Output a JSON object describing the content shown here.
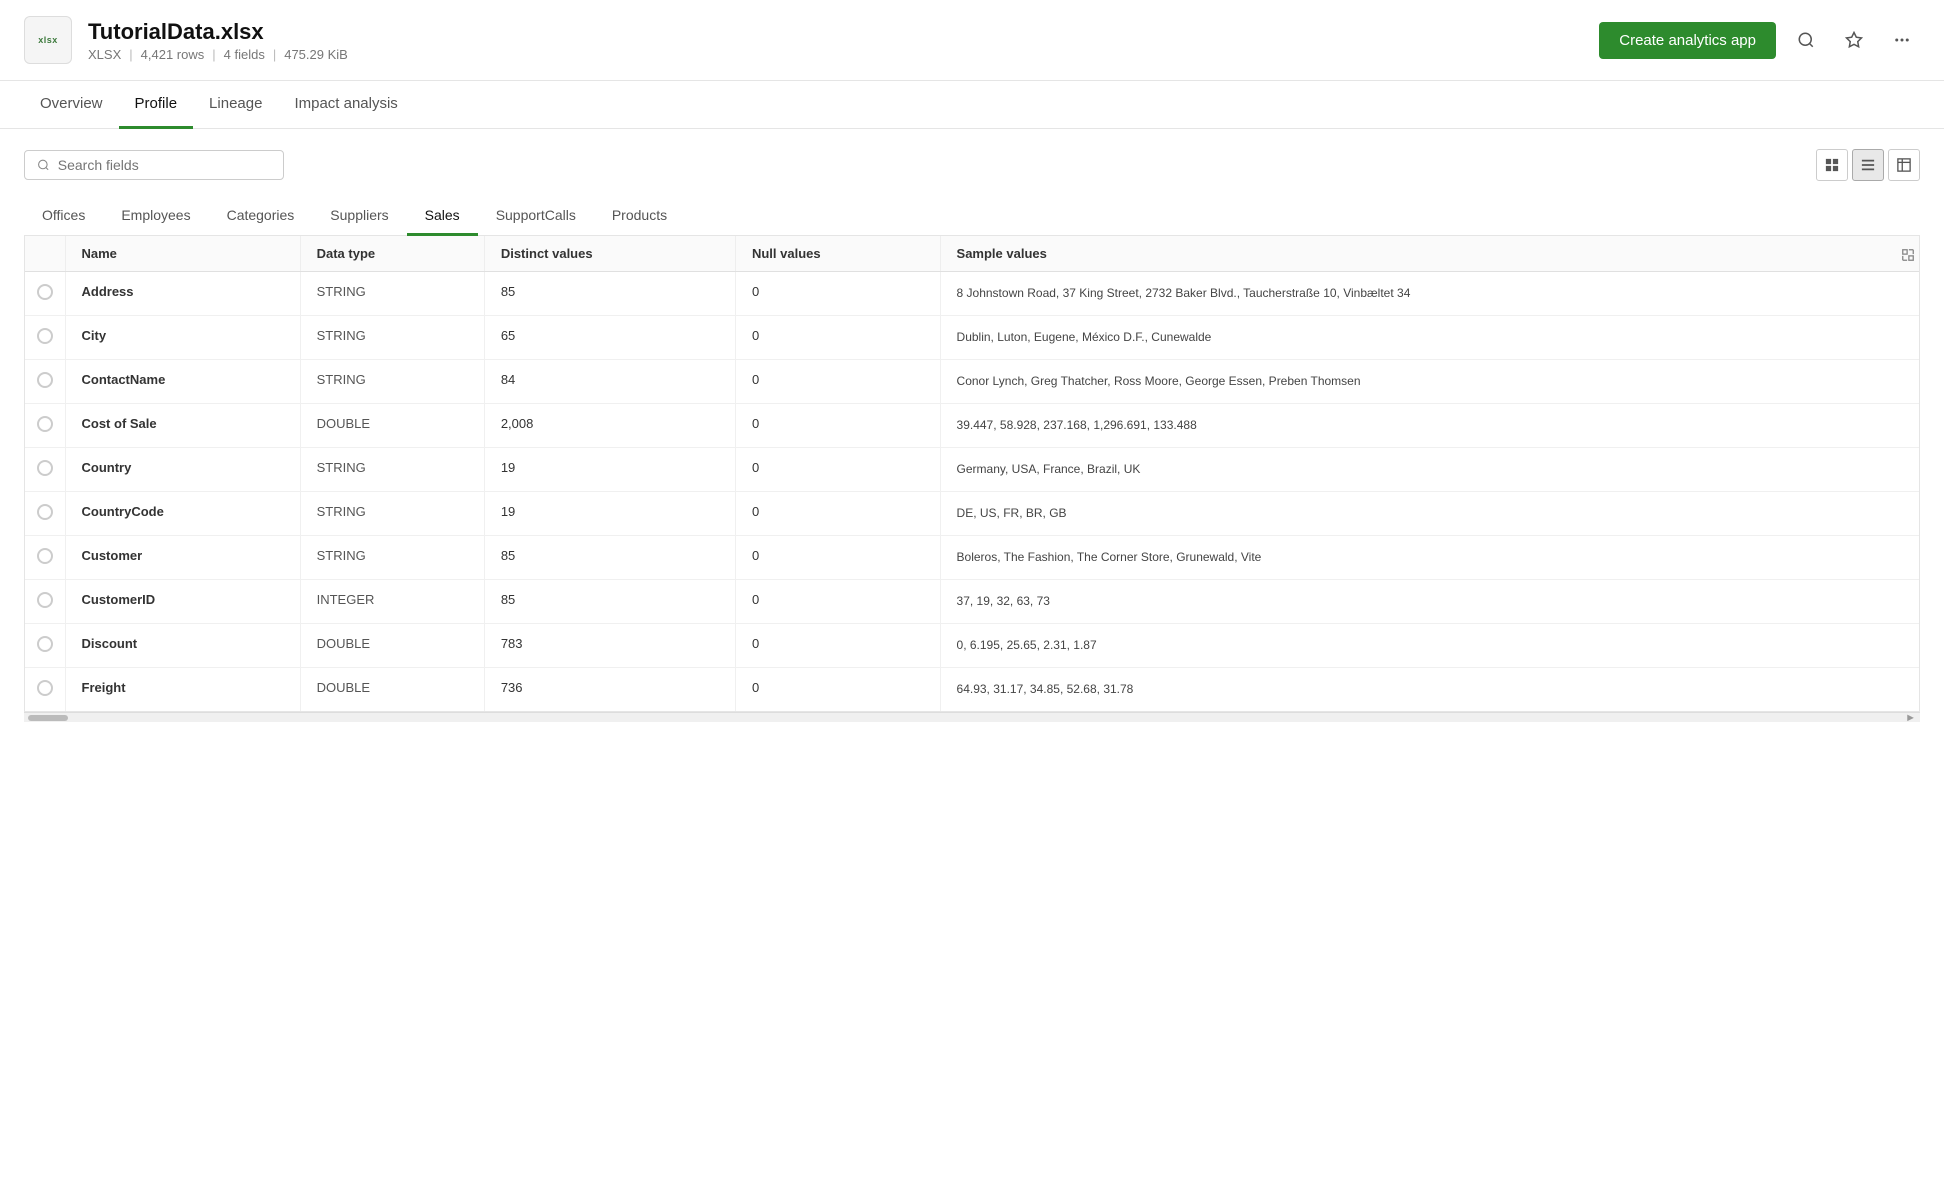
{
  "header": {
    "file_icon_label": "xlsx",
    "file_title": "TutorialData.xlsx",
    "file_type": "XLSX",
    "file_rows": "4,421 rows",
    "file_fields": "4 fields",
    "file_size": "475.29 KiB",
    "create_btn_label": "Create analytics app",
    "search_placeholder": "Search fields"
  },
  "tabs": [
    {
      "id": "overview",
      "label": "Overview",
      "active": false
    },
    {
      "id": "profile",
      "label": "Profile",
      "active": true
    },
    {
      "id": "lineage",
      "label": "Lineage",
      "active": false
    },
    {
      "id": "impact",
      "label": "Impact analysis",
      "active": false
    }
  ],
  "category_tabs": [
    {
      "id": "offices",
      "label": "Offices",
      "active": false
    },
    {
      "id": "employees",
      "label": "Employees",
      "active": false
    },
    {
      "id": "categories",
      "label": "Categories",
      "active": false
    },
    {
      "id": "suppliers",
      "label": "Suppliers",
      "active": false
    },
    {
      "id": "sales",
      "label": "Sales",
      "active": true
    },
    {
      "id": "supportcalls",
      "label": "SupportCalls",
      "active": false
    },
    {
      "id": "products",
      "label": "Products",
      "active": false
    }
  ],
  "table": {
    "columns": [
      {
        "id": "select",
        "label": ""
      },
      {
        "id": "name",
        "label": "Name"
      },
      {
        "id": "datatype",
        "label": "Data type"
      },
      {
        "id": "distinct",
        "label": "Distinct values"
      },
      {
        "id": "null",
        "label": "Null values"
      },
      {
        "id": "sample",
        "label": "Sample values"
      }
    ],
    "rows": [
      {
        "name": "Address",
        "datatype": "STRING",
        "distinct": "85",
        "null": "0",
        "sample": "8 Johnstown Road, 37 King Street, 2732 Baker Blvd., Taucherstraße 10, Vinbæltet 34"
      },
      {
        "name": "City",
        "datatype": "STRING",
        "distinct": "65",
        "null": "0",
        "sample": "Dublin, Luton, Eugene, México D.F., Cunewalde"
      },
      {
        "name": "ContactName",
        "datatype": "STRING",
        "distinct": "84",
        "null": "0",
        "sample": "Conor Lynch, Greg Thatcher, Ross Moore, George Essen, Preben Thomsen"
      },
      {
        "name": "Cost of Sale",
        "datatype": "DOUBLE",
        "distinct": "2,008",
        "null": "0",
        "sample": "39.447, 58.928, 237.168, 1,296.691, 133.488"
      },
      {
        "name": "Country",
        "datatype": "STRING",
        "distinct": "19",
        "null": "0",
        "sample": "Germany, USA, France, Brazil, UK"
      },
      {
        "name": "CountryCode",
        "datatype": "STRING",
        "distinct": "19",
        "null": "0",
        "sample": "DE, US, FR, BR, GB"
      },
      {
        "name": "Customer",
        "datatype": "STRING",
        "distinct": "85",
        "null": "0",
        "sample": "Boleros, The Fashion, The Corner Store, Grunewald, Vite"
      },
      {
        "name": "CustomerID",
        "datatype": "INTEGER",
        "distinct": "85",
        "null": "0",
        "sample": "37, 19, 32, 63, 73"
      },
      {
        "name": "Discount",
        "datatype": "DOUBLE",
        "distinct": "783",
        "null": "0",
        "sample": "0, 6.195, 25.65, 2.31, 1.87"
      },
      {
        "name": "Freight",
        "datatype": "DOUBLE",
        "distinct": "736",
        "null": "0",
        "sample": "64.93, 31.17, 34.85, 52.68, 31.78"
      }
    ]
  }
}
